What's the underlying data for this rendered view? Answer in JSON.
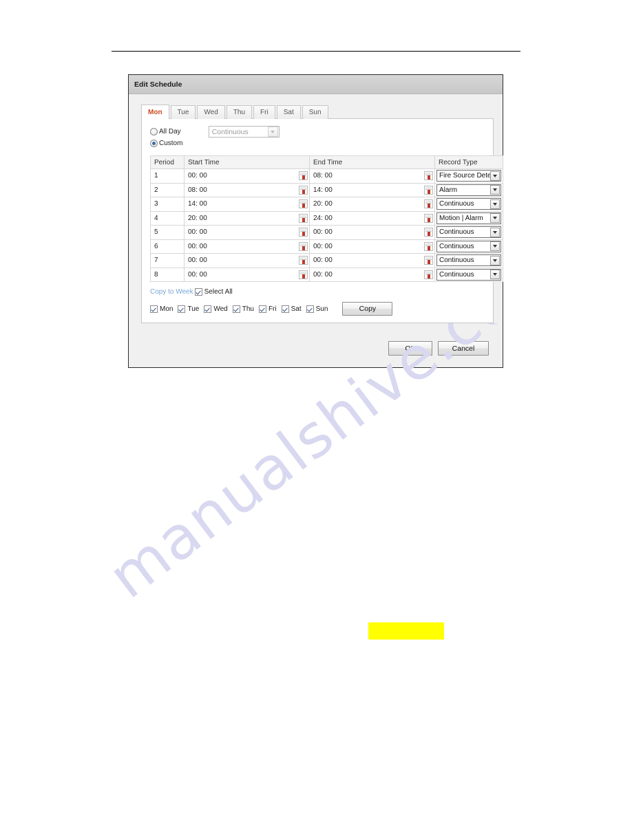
{
  "page": {
    "watermark_text": "manualshive.com",
    "highlight_label": ""
  },
  "dialog": {
    "title": "Edit Schedule",
    "tabs": [
      {
        "label": "Mon",
        "active": true
      },
      {
        "label": "Tue",
        "active": false
      },
      {
        "label": "Wed",
        "active": false
      },
      {
        "label": "Thu",
        "active": false
      },
      {
        "label": "Fri",
        "active": false
      },
      {
        "label": "Sat",
        "active": false
      },
      {
        "label": "Sun",
        "active": false
      }
    ],
    "mode": {
      "all_day_label": "All Day",
      "all_day_selected": false,
      "custom_label": "Custom",
      "custom_selected": true,
      "all_day_record_type": "Continuous",
      "all_day_record_type_enabled": false
    },
    "table": {
      "headers": [
        "Period",
        "Start Time",
        "End Time",
        "Record Type"
      ],
      "rows": [
        {
          "period": "1",
          "start": "00: 00",
          "end": "08: 00",
          "type": "Fire Source Detec"
        },
        {
          "period": "2",
          "start": "08: 00",
          "end": "14: 00",
          "type": "Alarm"
        },
        {
          "period": "3",
          "start": "14: 00",
          "end": "20: 00",
          "type": "Continuous"
        },
        {
          "period": "4",
          "start": "20: 00",
          "end": "24: 00",
          "type": "Motion | Alarm"
        },
        {
          "period": "5",
          "start": "00: 00",
          "end": "00: 00",
          "type": "Continuous"
        },
        {
          "period": "6",
          "start": "00: 00",
          "end": "00: 00",
          "type": "Continuous"
        },
        {
          "period": "7",
          "start": "00: 00",
          "end": "00: 00",
          "type": "Continuous"
        },
        {
          "period": "8",
          "start": "00: 00",
          "end": "00: 00",
          "type": "Continuous"
        }
      ]
    },
    "copy_week": {
      "link_label": "Copy to Week",
      "select_all_label": "Select All",
      "select_all_checked": true,
      "days": [
        {
          "label": "Mon",
          "checked": true
        },
        {
          "label": "Tue",
          "checked": true
        },
        {
          "label": "Wed",
          "checked": true
        },
        {
          "label": "Thu",
          "checked": true
        },
        {
          "label": "Fri",
          "checked": true
        },
        {
          "label": "Sat",
          "checked": true
        },
        {
          "label": "Sun",
          "checked": true
        }
      ],
      "copy_button_label": "Copy"
    },
    "footer": {
      "ok_label": "OK",
      "cancel_label": "Cancel"
    }
  }
}
